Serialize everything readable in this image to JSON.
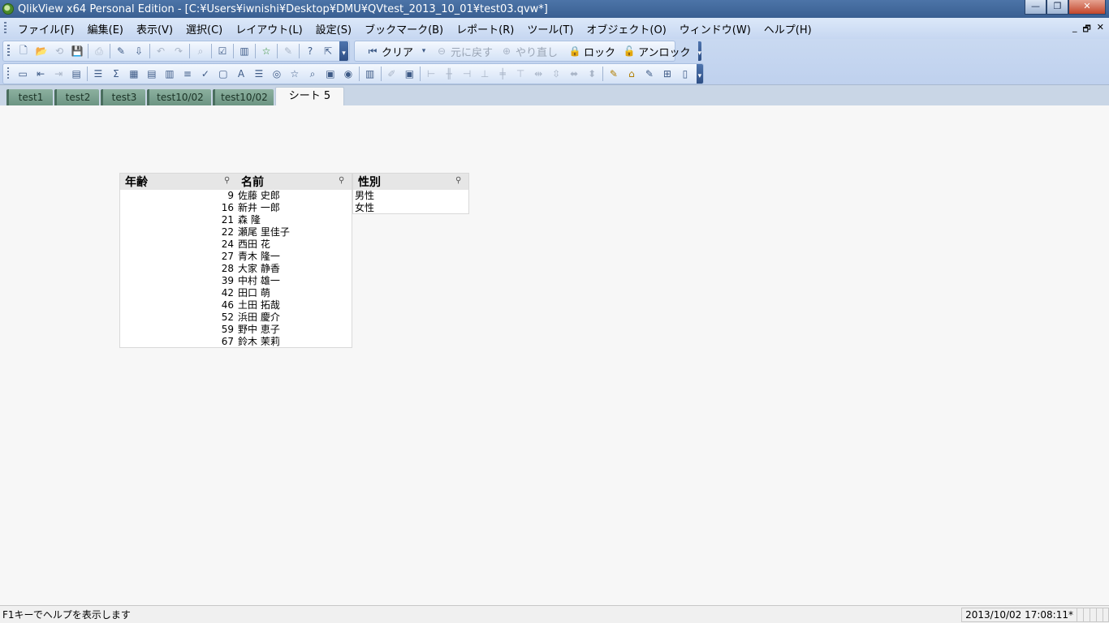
{
  "window": {
    "title": "QlikView x64 Personal Edition - [C:¥Users¥iwnishi¥Desktop¥DMU¥QVtest_2013_10_01¥test03.qvw*]",
    "buttons": {
      "minimize": "—",
      "maximize": "❐",
      "close": "✕"
    }
  },
  "menu": {
    "items": [
      "ファイル(F)",
      "編集(E)",
      "表示(V)",
      "選択(C)",
      "レイアウト(L)",
      "設定(S)",
      "ブックマーク(B)",
      "レポート(R)",
      "ツール(T)",
      "オブジェクト(O)",
      "ウィンドウ(W)",
      "ヘルプ(H)"
    ],
    "mdi": {
      "minimize": "_",
      "restore": "🗗",
      "close": "✕"
    }
  },
  "toolbar": {
    "clear": "クリア",
    "undo": "元に戻す",
    "redo": "やり直し",
    "lock": "ロック",
    "unlock": "アンロック"
  },
  "tabs": [
    "test1",
    "test2",
    "test3",
    "test10/02",
    "test10/02",
    "シート 5"
  ],
  "listboxes": {
    "age": {
      "caption": "年齢",
      "values": [
        "9",
        "16",
        "21",
        "22",
        "24",
        "27",
        "28",
        "39",
        "42",
        "46",
        "52",
        "59",
        "67"
      ]
    },
    "name": {
      "caption": "名前",
      "values": [
        "佐藤 史郎",
        "新井 一郎",
        "森 隆",
        "瀬尾 里佳子",
        "西田 花",
        "青木 隆一",
        "大家 静香",
        "中村 雄一",
        "田口 萌",
        "土田 拓哉",
        "浜田 慶介",
        "野中 恵子",
        "鈴木 茉莉"
      ]
    },
    "gender": {
      "caption": "性別",
      "values": [
        "男性",
        "女性"
      ]
    }
  },
  "status": {
    "help": "F1キーでヘルプを表示します",
    "timestamp": "2013/10/02 17:08:11*"
  }
}
